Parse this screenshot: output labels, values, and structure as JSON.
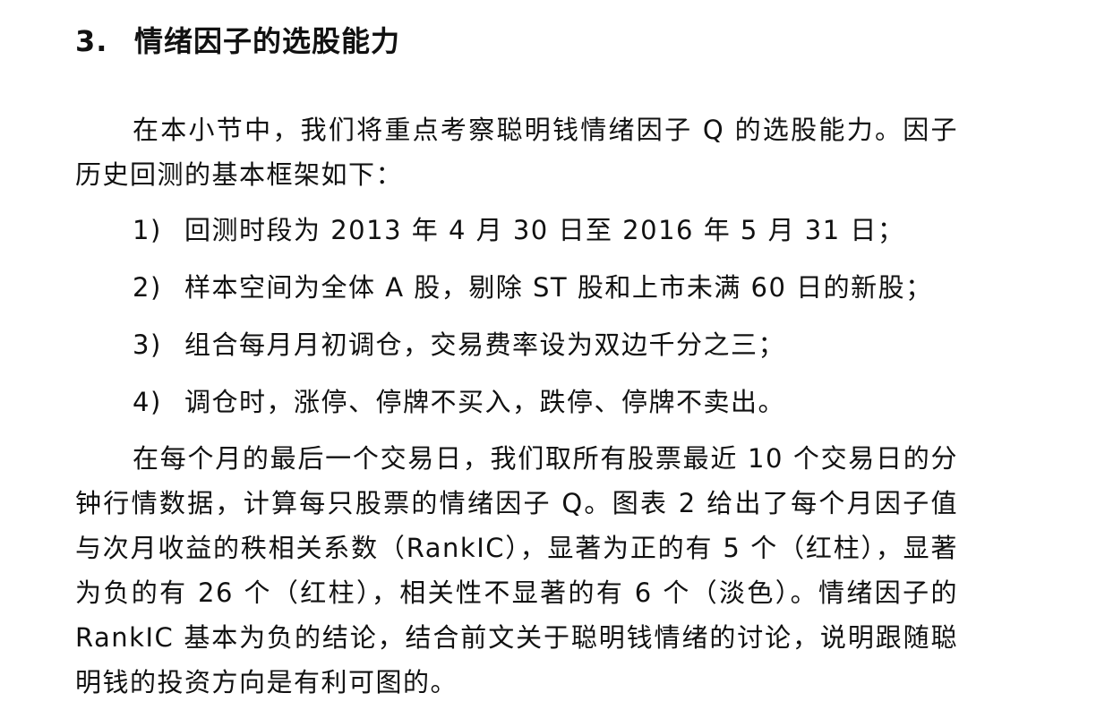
{
  "section": {
    "number": "3.",
    "title": "情绪因子的选股能力"
  },
  "intro": "在本小节中，我们将重点考察聪明钱情绪因子 Q 的选股能力。因子历史回测的基本框架如下：",
  "framework": [
    {
      "marker": "1)",
      "text": "回测时段为 2013 年 4 月 30 日至 2016 年 5 月 31 日；"
    },
    {
      "marker": "2)",
      "text": "样本空间为全体 A 股，剔除 ST 股和上市未满 60 日的新股；"
    },
    {
      "marker": "3)",
      "text": "组合每月月初调仓，交易费率设为双边千分之三；"
    },
    {
      "marker": "4)",
      "text": "调仓时，涨停、停牌不买入，跌停、停牌不卖出。"
    }
  ],
  "body": "在每个月的最后一个交易日，我们取所有股票最近 10 个交易日的分钟行情数据，计算每只股票的情绪因子 Q。图表 2 给出了每个月因子值与次月收益的秩相关系数（RankIC），显著为正的有 5 个（红柱），显著为负的有 26 个（红柱），相关性不显著的有 6 个（淡色）。情绪因子的 RankIC 基本为负的结论，结合前文关于聪明钱情绪的讨论，说明跟随聪明钱的投资方向是有利可图的。"
}
